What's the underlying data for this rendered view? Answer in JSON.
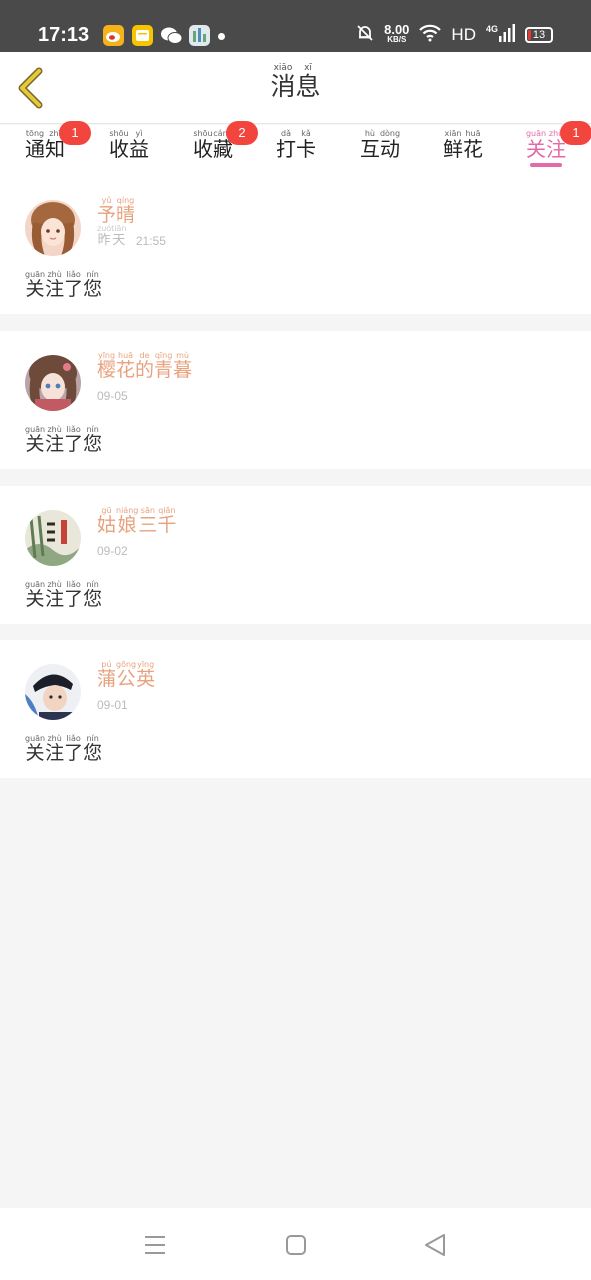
{
  "status_bar": {
    "time": "17:13",
    "net_speed_value": "8.00",
    "net_speed_unit": "KB/S",
    "hd_label": "HD",
    "network_type": "4G",
    "battery": "13"
  },
  "header": {
    "title_hanzi": [
      "消",
      "息"
    ],
    "title_pinyin": [
      "xiāo",
      "xī"
    ]
  },
  "tabs": [
    {
      "hanzi": [
        "通",
        "知"
      ],
      "pinyin": [
        "tōng",
        "zhī"
      ],
      "badge": "1"
    },
    {
      "hanzi": [
        "收",
        "益"
      ],
      "pinyin": [
        "shōu",
        "yì"
      ],
      "badge": ""
    },
    {
      "hanzi": [
        "收",
        "藏"
      ],
      "pinyin": [
        "shōu",
        "cáng"
      ],
      "badge": "2"
    },
    {
      "hanzi": [
        "打",
        "卡"
      ],
      "pinyin": [
        "dǎ",
        "kǎ"
      ],
      "badge": ""
    },
    {
      "hanzi": [
        "互",
        "动"
      ],
      "pinyin": [
        "hù",
        "dòng"
      ],
      "badge": ""
    },
    {
      "hanzi": [
        "鲜",
        "花"
      ],
      "pinyin": [
        "xiān",
        "huā"
      ],
      "badge": ""
    },
    {
      "hanzi": [
        "关",
        "注"
      ],
      "pinyin": [
        "guān",
        "zhù"
      ],
      "badge": "1",
      "active": true
    }
  ],
  "messages": [
    {
      "name_hanzi": [
        "予",
        "晴"
      ],
      "name_pinyin": [
        "yǔ",
        "qíng"
      ],
      "date_hanzi": [
        "昨",
        "天"
      ],
      "date_pinyin": [
        "zuó",
        "tiān"
      ],
      "date_time": "21:55",
      "text_hanzi": [
        "关",
        "注",
        "了",
        "您"
      ],
      "text_pinyin": [
        "guān",
        "zhù",
        "liǎo",
        "nín"
      ]
    },
    {
      "name_hanzi": [
        "樱",
        "花",
        "的",
        "青",
        "暮"
      ],
      "name_pinyin": [
        "yīng",
        "huā",
        "de",
        "qīng",
        "mù"
      ],
      "date": "09-05",
      "text_hanzi": [
        "关",
        "注",
        "了",
        "您"
      ],
      "text_pinyin": [
        "guān",
        "zhù",
        "liǎo",
        "nín"
      ]
    },
    {
      "name_hanzi": [
        "姑",
        "娘",
        "三",
        "千"
      ],
      "name_pinyin": [
        "gū",
        "niáng",
        "sān",
        "qiān"
      ],
      "date": "09-02",
      "text_hanzi": [
        "关",
        "注",
        "了",
        "您"
      ],
      "text_pinyin": [
        "guān",
        "zhù",
        "liǎo",
        "nín"
      ]
    },
    {
      "name_hanzi": [
        "蒲",
        "公",
        "英"
      ],
      "name_pinyin": [
        "pú",
        "gōng",
        "yīng"
      ],
      "date": "09-01",
      "text_hanzi": [
        "关",
        "注",
        "了",
        "您"
      ],
      "text_pinyin": [
        "guān",
        "zhù",
        "liǎo",
        "nín"
      ]
    }
  ],
  "colors": {
    "accent_pink": "#e36aa6",
    "username_orange": "#e8a27e",
    "badge_red": "#f2453d",
    "back_arrow": "#e6c93a"
  },
  "icons": {
    "back": "chevron-left-icon",
    "nav_menu": "menu-icon",
    "nav_home": "home-square-icon",
    "nav_back": "triangle-back-icon"
  }
}
